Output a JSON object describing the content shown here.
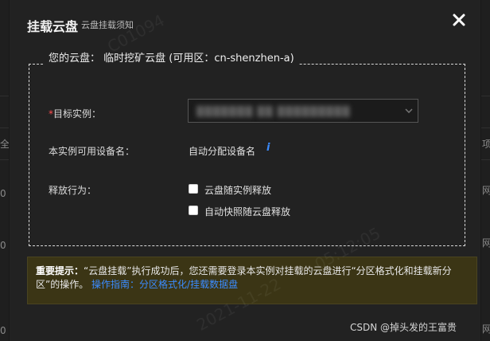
{
  "colors": {
    "background": "#1e1e1e",
    "dialog_background": "#222222",
    "accent_blue": "#3b8cff",
    "required_red": "#ff4d4f",
    "tip_background": "#3b3515"
  },
  "dialog": {
    "title": "挂载云盘",
    "subtitle": "云盘挂载须知",
    "close_icon": "close-icon"
  },
  "fieldset": {
    "legend": "您的云盘：  临时挖矿云盘 (可用区：cn-shenzhen-a)"
  },
  "form": {
    "target_instance": {
      "required_mark": "*",
      "label": "目标实例：",
      "value_obscured": "▒▒▒▒▒▒▒ ▒▒ ▒▒▒▒▒▒▒▒▒",
      "icon": "chevron-down-icon"
    },
    "device_name": {
      "label": "本实例可用设备名：",
      "value": "自动分配设备名",
      "icon": "info-icon",
      "icon_glyph": "i"
    },
    "release": {
      "label": "释放行为：",
      "options": [
        {
          "label": "云盘随实例释放",
          "checked": false
        },
        {
          "label": "自动快照随云盘释放",
          "checked": false
        }
      ]
    }
  },
  "tip": {
    "heading": "重要提示：",
    "body": "“云盘挂载”执行成功后，您还需要登录本实例对挂载的云盘进行“分区格式化和挂载新分区”的操作。",
    "link": "操作指南：分区格式化/挂载数据盘"
  },
  "background_fragments": [
    "全",
    "0 I0",
    "0 I0",
    "0 I0",
    "项",
    "网",
    "网",
    "网"
  ],
  "watermarks": [
    "2021-11-22",
    "1094",
    "C01094",
    "05:12:05"
  ],
  "credit": "CSDN @掉头发的王富贵"
}
